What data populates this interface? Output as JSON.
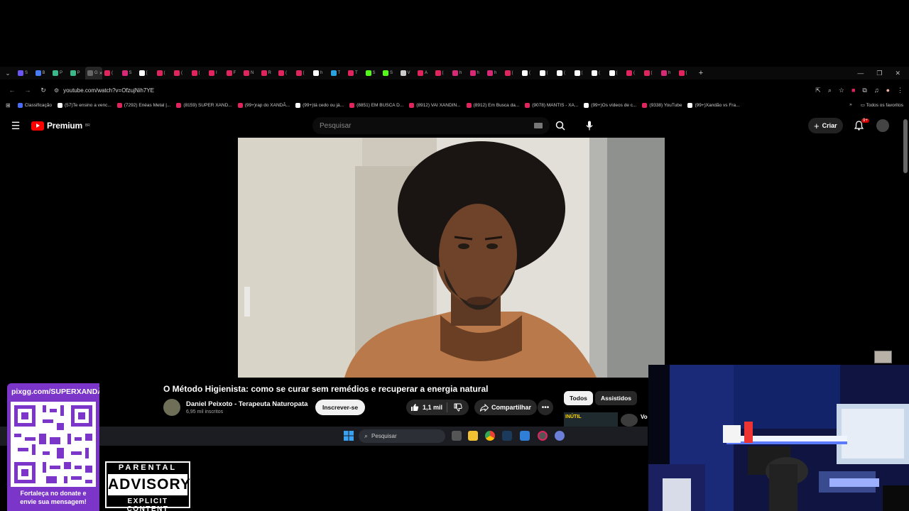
{
  "browser": {
    "tabs": [
      {
        "label": "S",
        "color": "#6b56f5"
      },
      {
        "label": "B",
        "color": "#4a7cf6"
      },
      {
        "label": "P",
        "color": "#3ab88a"
      },
      {
        "label": "P",
        "color": "#3ab88a"
      },
      {
        "label": "G",
        "color": "#666666",
        "active": true
      },
      {
        "label": "(",
        "color": "#e0245e"
      },
      {
        "label": "S",
        "color": "#d62976"
      },
      {
        "label": "[",
        "color": "#ffffff"
      },
      {
        "label": "(",
        "color": "#e0245e"
      },
      {
        "label": "(",
        "color": "#e0245e"
      },
      {
        "label": "(",
        "color": "#e0245e"
      },
      {
        "label": "I",
        "color": "#e0245e"
      },
      {
        "label": "F",
        "color": "#e0245e"
      },
      {
        "label": "N",
        "color": "#e0245e"
      },
      {
        "label": "R",
        "color": "#e0245e"
      },
      {
        "label": "(",
        "color": "#e0245e"
      },
      {
        "label": "(",
        "color": "#e0245e"
      },
      {
        "label": "h",
        "color": "#ffffff"
      },
      {
        "label": "T",
        "color": "#2aa3e0"
      },
      {
        "label": "T",
        "color": "#e0245e"
      },
      {
        "label": "S",
        "color": "#53fc18"
      },
      {
        "label": "S",
        "color": "#53fc18"
      },
      {
        "label": "V",
        "color": "#cccccc"
      },
      {
        "label": "A",
        "color": "#e0245e"
      },
      {
        "label": "(",
        "color": "#e0245e"
      },
      {
        "label": "h",
        "color": "#d62976"
      },
      {
        "label": "h",
        "color": "#d62976"
      },
      {
        "label": "h",
        "color": "#d62976"
      },
      {
        "label": "(",
        "color": "#e0245e"
      },
      {
        "label": "(",
        "color": "#ffffff"
      },
      {
        "label": "(",
        "color": "#ffffff"
      },
      {
        "label": "(",
        "color": "#ffffff"
      },
      {
        "label": "(",
        "color": "#ffffff"
      },
      {
        "label": "(",
        "color": "#ffffff"
      },
      {
        "label": "(",
        "color": "#ffffff"
      },
      {
        "label": "(",
        "color": "#e0245e"
      },
      {
        "label": "(",
        "color": "#e0245e"
      },
      {
        "label": "h",
        "color": "#d62976"
      },
      {
        "label": "(",
        "color": "#e0245e"
      }
    ],
    "url": "youtube.com/watch?v=OfzujNih7YE",
    "bookmarks": [
      {
        "label": "Classificação",
        "color": "#4a6cf7"
      },
      {
        "label": "(57)Te ensino a venc...",
        "color": "#ffffff"
      },
      {
        "label": "(7292) Enéas Metal |...",
        "color": "#e0245e"
      },
      {
        "label": "(8159) SUPER XAND...",
        "color": "#e0245e"
      },
      {
        "label": "(99+)rap do XANDÃ...",
        "color": "#e0245e"
      },
      {
        "label": "(99+)tá cedo ou já...",
        "color": "#ffffff"
      },
      {
        "label": "(8851) EM BUSCA D...",
        "color": "#e0245e"
      },
      {
        "label": "(8912) VAI XANDIN...",
        "color": "#e0245e"
      },
      {
        "label": "(8912) Em Busca da...",
        "color": "#e0245e"
      },
      {
        "label": "(9078) MANTIS - XA...",
        "color": "#e0245e"
      },
      {
        "label": "(99+)Os vídeos de c...",
        "color": "#ffffff"
      },
      {
        "label": "(9338) YouTube",
        "color": "#e0245e"
      },
      {
        "label": "(99+)Xandão vs Fra...",
        "color": "#ffffff"
      }
    ],
    "all_bookmarks": "Todos os favoritos"
  },
  "youtube": {
    "logo_text": "Premium",
    "logo_country": "BR",
    "search_placeholder": "Pesquisar",
    "create_label": "Criar",
    "notifications_badge": "9+",
    "video_title": "O Método Higienista: como se curar sem remédios e recuperar a energia natural",
    "channel_name": "Daniel Peixoto - Terapeuta Naturopata",
    "channel_subs": "6,95 mil inscritos",
    "subscribe_label": "Inscrever-se",
    "likes": "1,1 mil",
    "share_label": "Compartilhar",
    "chips": [
      "Todos",
      "Assistidos"
    ],
    "rec_thumb_text": "INÚTIL",
    "rec_title": "Vo"
  },
  "taskbar": {
    "search_placeholder": "Pesquisar"
  },
  "overlay": {
    "donate_url": "pixgg.com/SUPERXANDÃO",
    "donate_message_line1": "Fortaleça no donate e",
    "donate_message_line2": "envie sua mensagem!",
    "advisory_top": "PARENTAL",
    "advisory_mid": "ADVISORY",
    "advisory_bottom": "EXPLICIT CONTENT"
  },
  "colors": {
    "yt_red": "#ff0000",
    "donate_purple": "#7b35c9",
    "taskbar": "#1b1d22"
  }
}
